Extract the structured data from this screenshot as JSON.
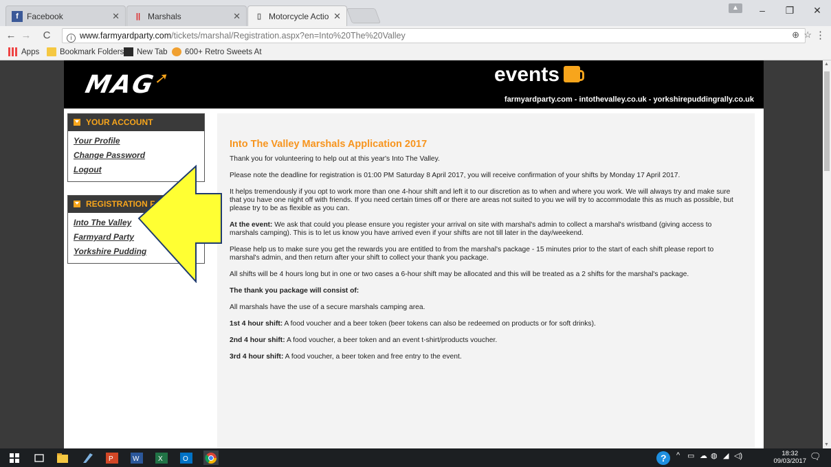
{
  "tabs": [
    {
      "label": "Facebook",
      "icon": "facebook-icon"
    },
    {
      "label": "Marshals",
      "icon": "marshals-icon"
    },
    {
      "label": "Motorcycle Action Group",
      "icon": "page-icon"
    }
  ],
  "address": {
    "host": "www.farmyardparty.com",
    "path": "/tickets/marshal/Registration.aspx?en=Into%20The%20Valley"
  },
  "bookmarks": [
    {
      "label": "Apps",
      "icon": "apps-icon"
    },
    {
      "label": "Bookmark Folders",
      "icon": "folder-icon"
    },
    {
      "label": "New Tab",
      "icon": "newtab-icon"
    },
    {
      "label": "600+ Retro Sweets At",
      "icon": "sweets-icon"
    }
  ],
  "site": {
    "logo_text": "MAG",
    "events_title": "events",
    "links": "farmyardparty.com - intothevalley.co.uk - yorkshirepuddingrally.co.uk"
  },
  "sidebar": {
    "account": {
      "title": "YOUR ACCOUNT",
      "links": [
        "Your Profile",
        "Change Password",
        "Logout"
      ]
    },
    "registration": {
      "title": "REGISTRATION FOR",
      "links": [
        "Into The Valley",
        "Farmyard Party",
        "Yorkshire Pudding"
      ]
    }
  },
  "content": {
    "heading": "Into The Valley Marshals Application 2017",
    "p1": "Thank you for volunteering to help out at this year's Into The Valley.",
    "p2": "Please note the deadline for registration is 01:00 PM Saturday 8 April 2017, you will receive confirmation of your shifts by Monday 17 April 2017.",
    "p3": "It helps tremendously if you opt to work more than one 4-hour shift and left it to our discretion as to when and where you work. We will always try and make sure that you have one night off with friends. If you need certain times off or there are areas not suited to you we will try to accommodate this as much as possible, but please try to be as flexible as you can.",
    "p4_bold": "At the event:",
    "p4": " We ask that could you please ensure you register your arrival on site with marshal's admin to collect a marshal's wristband (giving access to marshals camping). This is to let us know you have arrived even if your shifts are not till later in the day/weekend.",
    "p5": "Please help us to make sure you get the rewards you are entitled to from the marshal's package - 15 minutes prior to the start of each shift please report to marshal's admin, and then return after your shift to collect your thank you package.",
    "p6": "All shifts will be 4 hours long but in one or two cases a 6-hour shift may be allocated and this will be treated as a 2 shifts for the marshal's package.",
    "p7_bold": "The thank you package will consist of:",
    "p8": "All marshals have the use of a secure marshals camping area.",
    "p9_bold": "1st 4 hour shift:",
    "p9": " A food voucher and a beer token (beer tokens can also be redeemed on products or for soft drinks).",
    "p10_bold": "2nd 4 hour shift:",
    "p10": " A food voucher, a beer token and an event t-shirt/products voucher.",
    "p11_bold": "3rd 4 hour shift:",
    "p11": " A food voucher, a beer token and free entry to the event."
  },
  "taskbar": {
    "time": "18:32",
    "date": "09/03/2017"
  },
  "colors": {
    "accent": "#f7941d",
    "arrow_fill": "#ffff33",
    "arrow_stroke": "#1f3b6e",
    "header_bg": "#000000"
  }
}
